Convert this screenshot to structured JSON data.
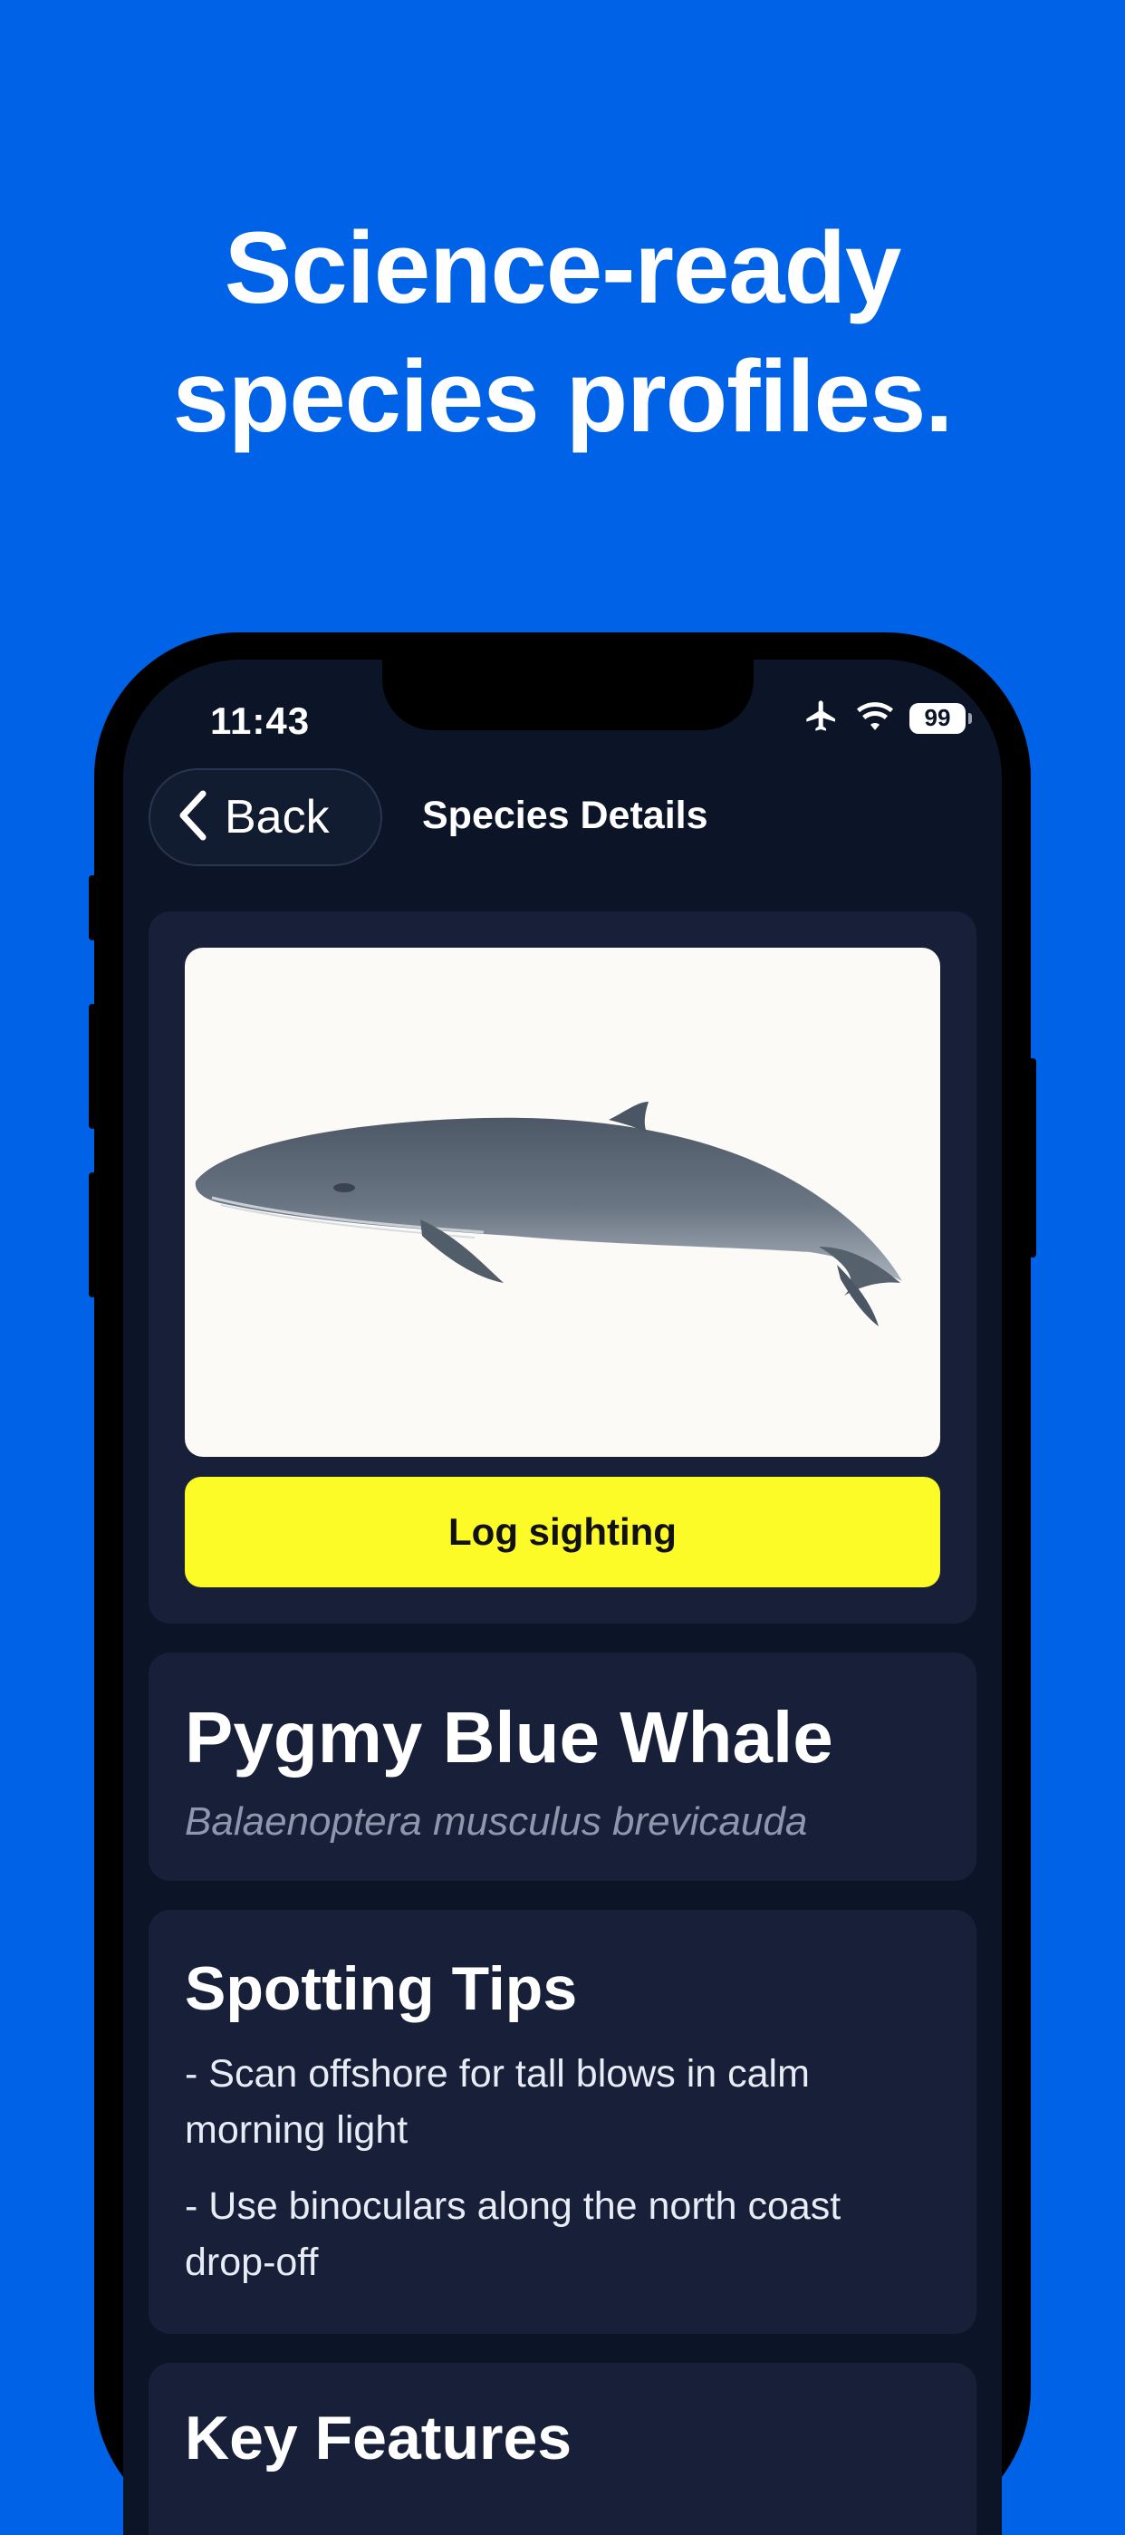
{
  "headline": {
    "line1": "Science-ready",
    "line2": "species profiles."
  },
  "status_bar": {
    "time": "11:43",
    "battery": "99"
  },
  "nav": {
    "back_label": "Back",
    "title": "Species Details"
  },
  "species": {
    "image_icon": "whale-illustration",
    "log_button": "Log sighting",
    "name": "Pygmy Blue Whale",
    "scientific_name": "Balaenoptera musculus brevicauda"
  },
  "spotting_tips": {
    "title": "Spotting Tips",
    "items": [
      "- Scan offshore for tall blows in calm morning light",
      "- Use binoculars along the north coast drop-off"
    ]
  },
  "key_features": {
    "title": "Key Features"
  },
  "colors": {
    "background": "#0062e6",
    "screen": "#0c1528",
    "card": "#172038",
    "accent": "#fdfb27"
  }
}
